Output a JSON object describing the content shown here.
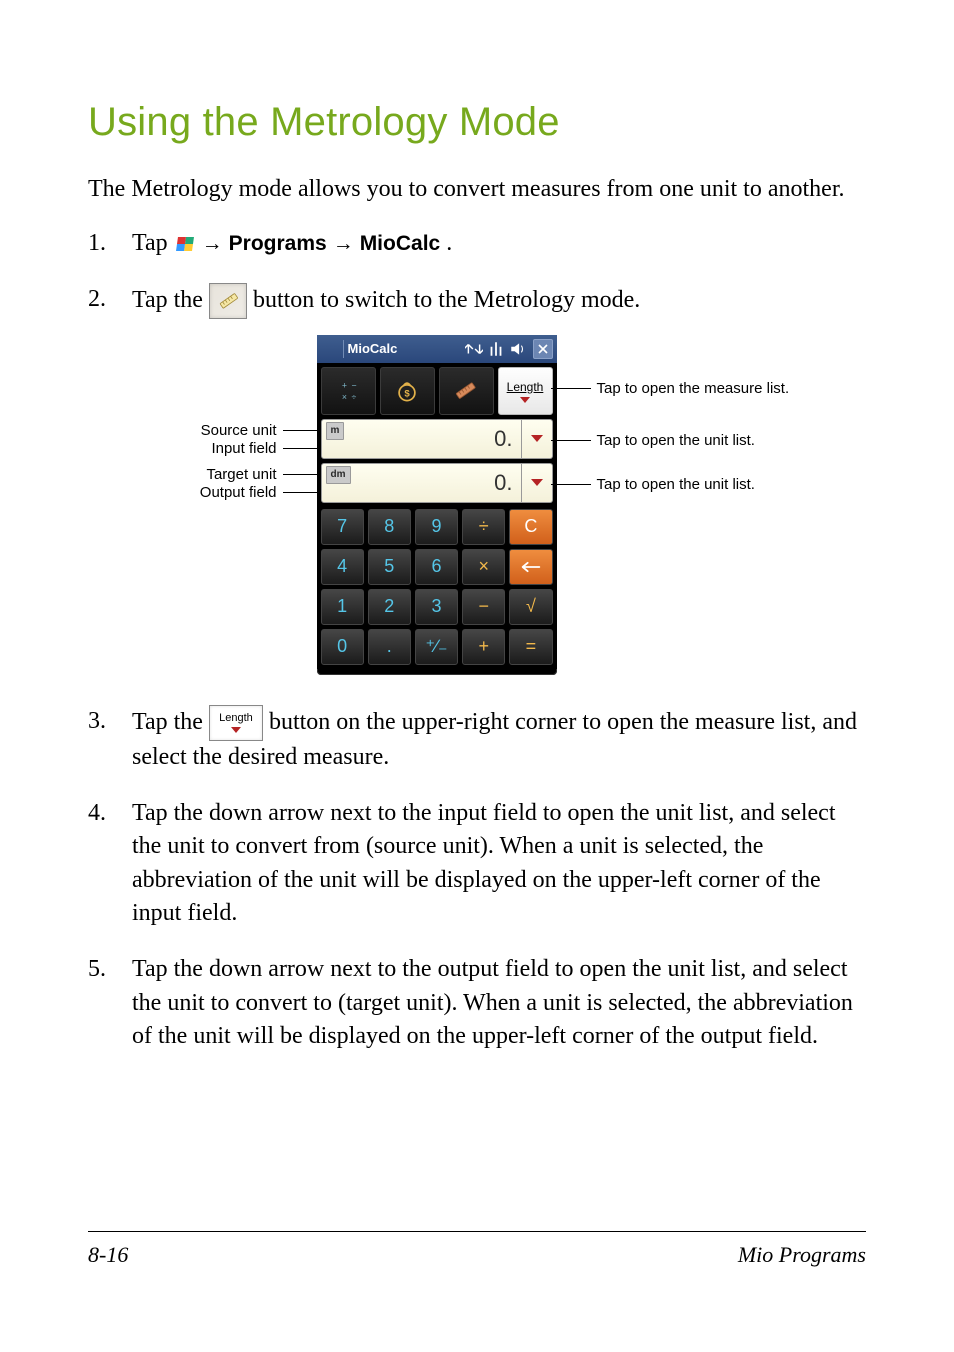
{
  "heading": "Using the Metrology Mode",
  "intro": "The Metrology mode allows you to convert measures from one unit to another.",
  "step1": {
    "prefix": "Tap",
    "programs": "Programs",
    "miocalc": "MioCalc",
    "period": "."
  },
  "step2": {
    "prefix": "Tap the",
    "suffix": "button to switch to the Metrology mode."
  },
  "step3": {
    "prefix": "Tap the",
    "suffix": "button on the upper-right corner to open the measure list, and select the desired measure."
  },
  "step4": "Tap the down arrow next to the input field to open the unit list, and select the unit to convert from (source unit). When a unit is selected, the abbreviation of the unit will be displayed on the upper-left corner of the input field.",
  "step5": "Tap the down arrow next to the output field to open the unit list, and select the unit to convert to (target unit). When a unit is selected, the abbreviation of the unit will be displayed on the upper-left corner of the output field.",
  "arrow_glyph": "→",
  "inline_length_label": "Length",
  "left_labels": {
    "source_unit": "Source unit",
    "input_field": "Input field",
    "target_unit": "Target unit",
    "output_field": "Output field"
  },
  "right_labels": {
    "measure_list": "Tap to open the measure list.",
    "unit_list_1": "Tap to open the unit list.",
    "unit_list_2": "Tap to open the unit list."
  },
  "device": {
    "title": "MioCalc",
    "length_btn_label": "Length",
    "input_unit": "m",
    "input_value": "0.",
    "output_unit": "dm",
    "output_value": "0.",
    "keys": {
      "k7": "7",
      "k8": "8",
      "k9": "9",
      "kdiv": "÷",
      "kC": "C",
      "k4": "4",
      "k5": "5",
      "k6": "6",
      "kmul": "×",
      "k1": "1",
      "k2": "2",
      "k3": "3",
      "ksub": "−",
      "ksqrt": "√",
      "k0": "0",
      "kdot": ".",
      "kpm": "⁺∕₋",
      "kadd": "+",
      "keq": "="
    }
  },
  "footer": {
    "page": "8-16",
    "section": "Mio Programs"
  }
}
